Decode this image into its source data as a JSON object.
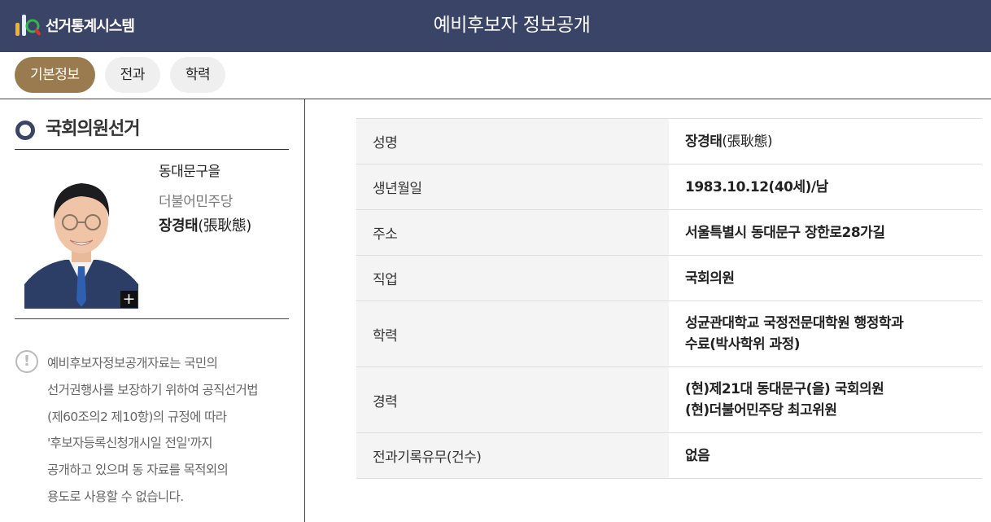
{
  "header": {
    "logo_text": "선거통계시스템",
    "title": "예비후보자 정보공개"
  },
  "tabs": [
    {
      "label": "기본정보",
      "active": true
    },
    {
      "label": "전과",
      "active": false
    },
    {
      "label": "학력",
      "active": false
    }
  ],
  "section": {
    "title": "국회의원선거"
  },
  "candidate": {
    "district": "동대문구을",
    "party": "더불어민주당",
    "name": "장경태",
    "name_hanja": "(張耿態)",
    "photo_expand": "+"
  },
  "notice": {
    "icon": "!",
    "lines": [
      "예비후보자정보공개자료는 국민의",
      "선거권행사를 보장하기 위하여 공직선거법",
      "(제60조의2 제10항)의 규정에 따라",
      "'후보자등록신청개시일 전일'까지",
      "공개하고 있으며 동 자료를 목적외의",
      "용도로 사용할 수 없습니다."
    ]
  },
  "info_rows": [
    {
      "label": "성명",
      "value_lines": [
        "장경태"
      ],
      "value_suffix": "(張耿態)"
    },
    {
      "label": "생년월일",
      "value_lines": [
        "1983.10.12(40세)/남"
      ]
    },
    {
      "label": "주소",
      "value_lines": [
        "서울특별시 동대문구 장한로28가길"
      ]
    },
    {
      "label": "직업",
      "value_lines": [
        "국회의원"
      ]
    },
    {
      "label": "학력",
      "value_lines": [
        "성균관대학교 국정전문대학원 행정학과",
        "수료(박사학위 과정)"
      ]
    },
    {
      "label": "경력",
      "value_lines": [
        "(현)제21대 동대문구(을) 국회의원",
        "(현)더불어민주당 최고위원"
      ]
    },
    {
      "label": "전과기록유무(건수)",
      "value_lines": [
        "없음"
      ]
    }
  ],
  "colors": {
    "header_bg": "#3a4466",
    "active_tab": "#9a7b4f",
    "inactive_tab": "#efefef",
    "label_bg": "#f4f4f4"
  }
}
